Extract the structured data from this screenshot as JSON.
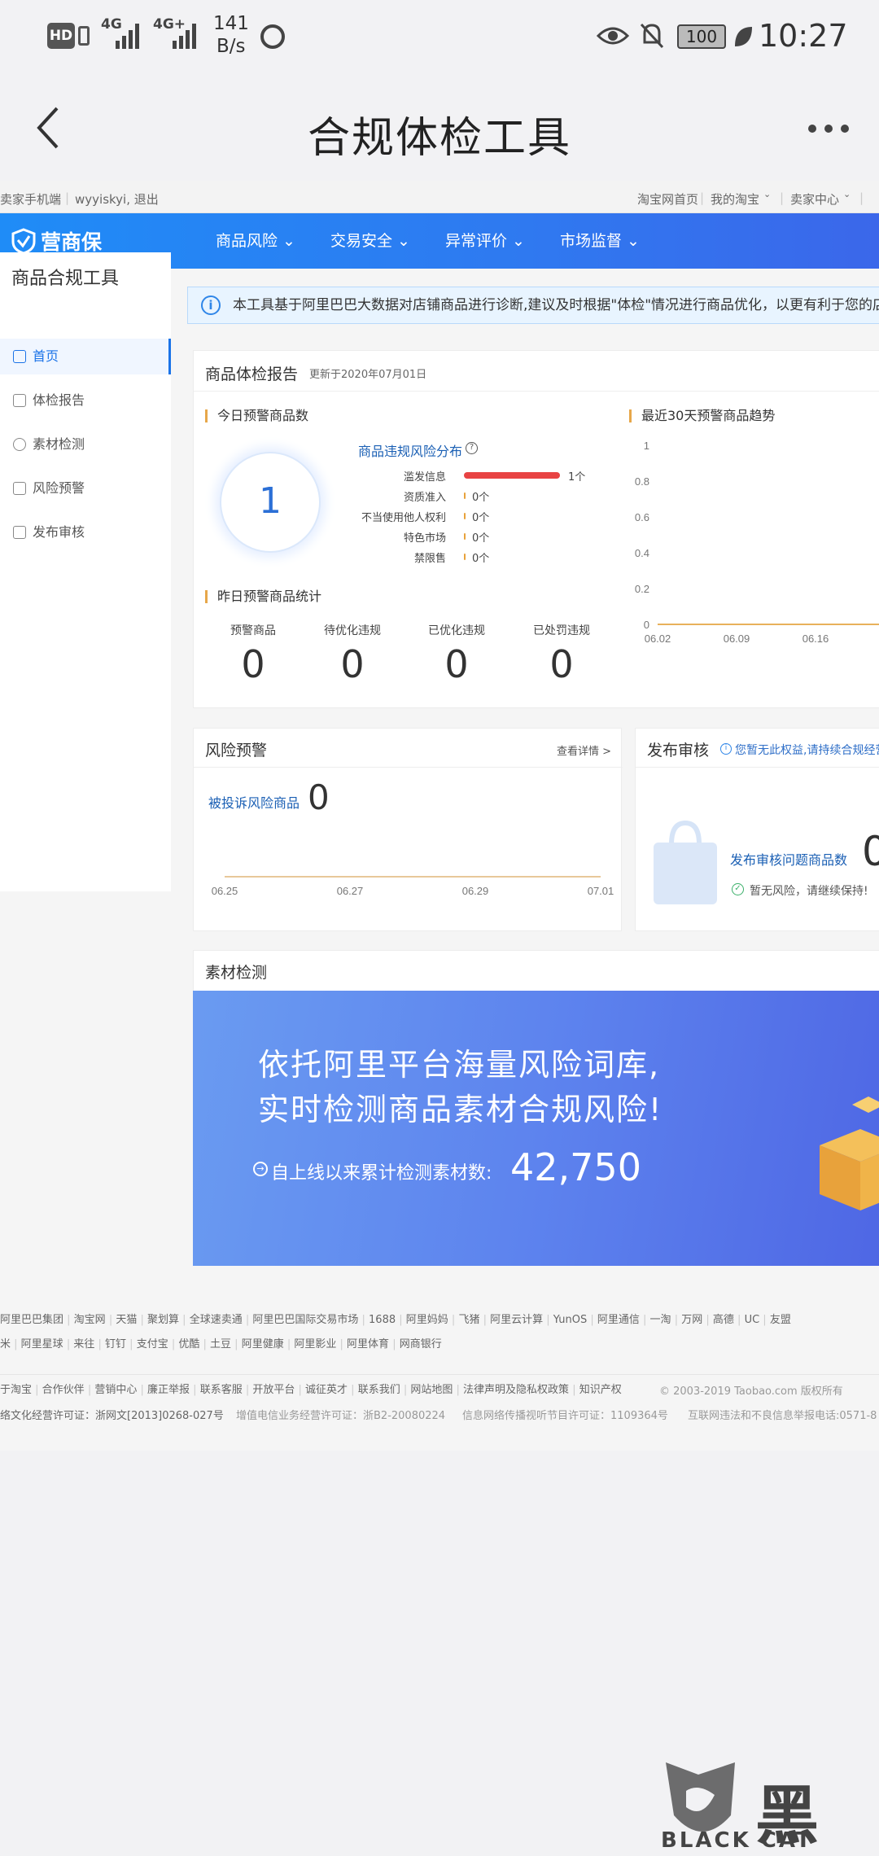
{
  "status_bar": {
    "hd": "HD",
    "net1": "4G",
    "net2": "4G+",
    "speed_value": "141",
    "speed_unit": "B/s",
    "battery": "100",
    "time": "10:27"
  },
  "app_bar": {
    "title": "合规体检工具"
  },
  "top_strip": {
    "left1": "卖家手机端",
    "left2": "wyyiskyi, 退出",
    "right1": "淘宝网首页",
    "right2": "我的淘宝",
    "right3": "卖家中心"
  },
  "nav": {
    "logo": "营商保",
    "items": [
      "商品风险",
      "交易安全",
      "异常评价",
      "市场监督"
    ]
  },
  "sidebar": {
    "title": "商品合规工具",
    "items": [
      "首页",
      "体检报告",
      "素材检测",
      "风险预警",
      "发布审核"
    ]
  },
  "notice": {
    "text": "本工具基于阿里巴巴大数据对店铺商品进行诊断,建议及时根据\"体检\"情况进行商品优化，以更有利于您的店铺经营"
  },
  "report": {
    "title": "商品体检报告",
    "updated": "更新于2020年07月01日",
    "today_title": "今日预警商品数",
    "today_count": "1",
    "dist_title": "商品违规风险分布",
    "dist_rows": [
      {
        "label": "滥发信息",
        "value": "1个",
        "fraction": 1.0
      },
      {
        "label": "资质准入",
        "value": "0个",
        "fraction": 0
      },
      {
        "label": "不当使用他人权利",
        "value": "0个",
        "fraction": 0
      },
      {
        "label": "特色市场",
        "value": "0个",
        "fraction": 0
      },
      {
        "label": "禁限售",
        "value": "0个",
        "fraction": 0
      }
    ],
    "yesterday_title": "昨日预警商品统计",
    "yesterday": [
      {
        "label": "预警商品",
        "value": "0"
      },
      {
        "label": "待优化违规",
        "value": "0"
      },
      {
        "label": "已优化违规",
        "value": "0"
      },
      {
        "label": "已处罚违规",
        "value": "0"
      }
    ],
    "trend_title": "最近30天预警商品趋势",
    "trend_yticks": [
      "1",
      "0.8",
      "0.6",
      "0.4",
      "0.2",
      "0"
    ],
    "trend_xticks": [
      "06.02",
      "06.09",
      "06.16"
    ]
  },
  "risk": {
    "title": "风险预警",
    "detail": "查看详情 >",
    "label": "被投诉风险商品",
    "count": "0",
    "xticks": [
      "06.25",
      "06.27",
      "06.29",
      "07.01"
    ]
  },
  "publish": {
    "title": "发布审核",
    "tip": "您暂无此权益,请持续合规经营",
    "label": "发布审核问题商品数",
    "count": "0",
    "ok": "暂无风险，请继续保持!"
  },
  "material": {
    "title": "素材检测",
    "line1": "依托阿里平台海量风险词库,",
    "line2": "实时检测商品素材合规风险!",
    "count_label": "自上线以来累计检测素材数:",
    "count": "42,750"
  },
  "footer": {
    "row1": [
      "阿里巴巴集团",
      "淘宝网",
      "天猫",
      "聚划算",
      "全球速卖通",
      "阿里巴巴国际交易市场",
      "1688",
      "阿里妈妈",
      "飞猪",
      "阿里云计算",
      "YunOS",
      "阿里通信",
      "一淘",
      "万网",
      "高德",
      "UC",
      "友盟"
    ],
    "row2": [
      "米",
      "阿里星球",
      "来往",
      "钉钉",
      "支付宝",
      "优酷",
      "土豆",
      "阿里健康",
      "阿里影业",
      "阿里体育",
      "网商银行"
    ],
    "row3": [
      "于淘宝",
      "合作伙伴",
      "营销中心",
      "廉正举报",
      "联系客服",
      "开放平台",
      "诚征英才",
      "联系我们",
      "网站地图",
      "法律声明及隐私权政策",
      "知识产权"
    ],
    "copyright": "© 2003-2019 Taobao.com 版权所有",
    "row4a": "络文化经营许可证：浙网文[2013]0268-027号",
    "row4b": "增值电信业务经营许可证：浙B2-20080224",
    "row4c": "信息网络传播视听节目许可证：1109364号",
    "row4d": "互联网违法和不良信息举报电话:0571-8"
  },
  "watermark": {
    "cn": "黑猫",
    "en": "BLACK CAT"
  }
}
